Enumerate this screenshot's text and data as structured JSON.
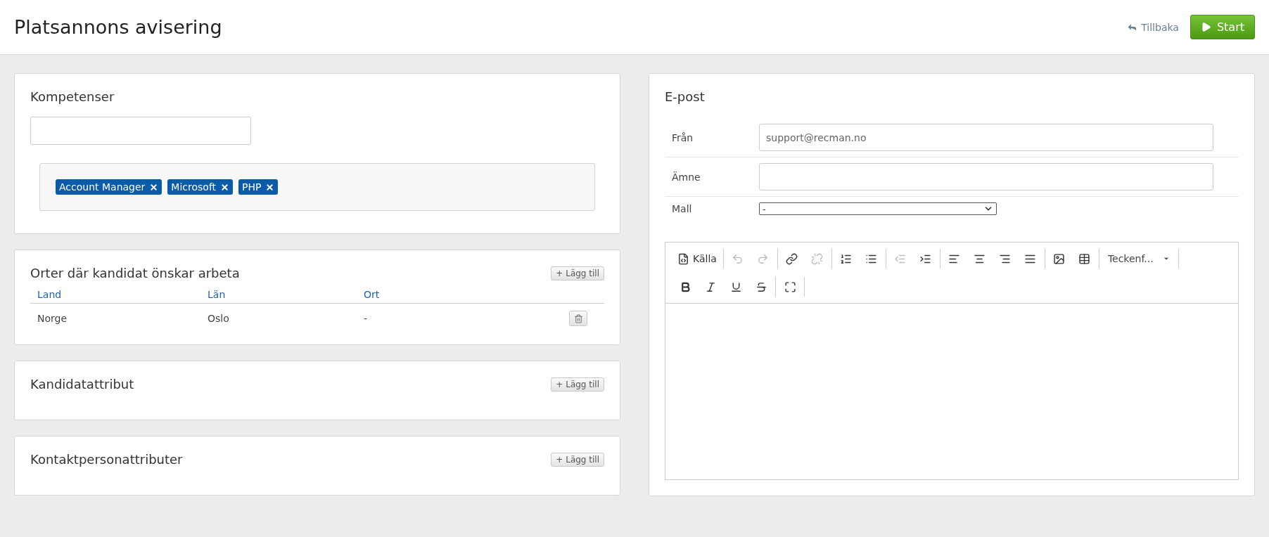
{
  "header": {
    "title": "Platsannons avisering",
    "back_link": "Tillbaka",
    "start_button": "Start"
  },
  "competences": {
    "title": "Kompetenser",
    "tags": [
      "Account Manager",
      "Microsoft",
      "PHP"
    ]
  },
  "locations": {
    "title": "Orter där kandidat önskar arbeta",
    "add_button": "+ Lägg till",
    "columns": [
      "Land",
      "Län",
      "Ort"
    ],
    "rows": [
      {
        "cells": [
          "Norge",
          "Oslo",
          "-"
        ]
      }
    ]
  },
  "candidate_attributes": {
    "title": "Kandidatattribut",
    "add_button": "+ Lägg till"
  },
  "contact_attributes": {
    "title": "Kontaktpersonattributer",
    "add_button": "+ Lägg till"
  },
  "email": {
    "title": "E-post",
    "fields": [
      {
        "kind": "input",
        "label": "Från",
        "value": "support@recman.no"
      },
      {
        "kind": "input",
        "label": "Ämne"
      },
      {
        "kind": "select",
        "label": "Mall",
        "value": "-"
      }
    ],
    "toolbar_rows": [
      [
        [
          {
            "kind": "source",
            "label": "Källa",
            "disabled": false
          }
        ],
        [
          {
            "kind": "undo",
            "disabled": true
          },
          {
            "kind": "redo",
            "disabled": true
          }
        ],
        [
          {
            "kind": "link",
            "disabled": false
          },
          {
            "kind": "unlink",
            "disabled": true
          }
        ],
        [
          {
            "kind": "ordered-list",
            "disabled": false
          },
          {
            "kind": "bullet-list",
            "disabled": false
          }
        ],
        [
          {
            "kind": "outdent",
            "disabled": true
          },
          {
            "kind": "indent",
            "disabled": false
          }
        ],
        [
          {
            "kind": "align-left",
            "disabled": false
          },
          {
            "kind": "align-center",
            "disabled": false
          },
          {
            "kind": "align-right",
            "disabled": false
          },
          {
            "kind": "align-justify",
            "disabled": false
          }
        ],
        [
          {
            "kind": "image",
            "disabled": false
          },
          {
            "kind": "table",
            "disabled": false
          }
        ],
        [
          {
            "kind": "font",
            "label": "Teckenf..."
          }
        ]
      ],
      [
        [
          {
            "kind": "bold",
            "disabled": false
          },
          {
            "kind": "italic",
            "disabled": false
          },
          {
            "kind": "underline",
            "disabled": false
          },
          {
            "kind": "strike",
            "disabled": false
          }
        ],
        [
          {
            "kind": "maximize",
            "disabled": false
          }
        ]
      ]
    ]
  }
}
